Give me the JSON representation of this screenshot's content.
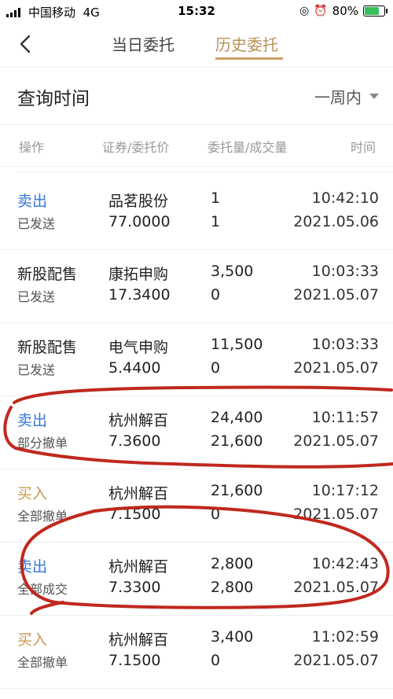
{
  "status_bar": {
    "carrier": "中国移动",
    "network": "4G",
    "time": "15:32",
    "battery_percent": "80%",
    "battery_level": 0.8
  },
  "header": {
    "tabs": [
      {
        "label": "当日委托",
        "active": false
      },
      {
        "label": "历史委托",
        "active": true
      }
    ],
    "accent_color": "#c9a063"
  },
  "query": {
    "label": "查询时间",
    "range_value": "一周内"
  },
  "columns": [
    "操作",
    "证券/委托价",
    "委托量/成交量",
    "时间"
  ],
  "orders": [
    {
      "op": "卖出",
      "side": "sell",
      "status": "已发送",
      "name": "品茗股份",
      "price": "77.0000",
      "qty": "1",
      "deal": "1",
      "time": "10:42:10",
      "date": "2021.05.06"
    },
    {
      "op": "新股配售",
      "side": "other",
      "status": "已发送",
      "name": "康拓申购",
      "price": "17.3400",
      "qty": "3,500",
      "deal": "0",
      "time": "10:03:33",
      "date": "2021.05.07"
    },
    {
      "op": "新股配售",
      "side": "other",
      "status": "已发送",
      "name": "电气申购",
      "price": "5.4400",
      "qty": "11,500",
      "deal": "0",
      "time": "10:03:33",
      "date": "2021.05.07"
    },
    {
      "op": "卖出",
      "side": "sell",
      "status": "部分撤单",
      "name": "杭州解百",
      "price": "7.3600",
      "qty": "24,400",
      "deal": "21,600",
      "time": "10:11:57",
      "date": "2021.05.07"
    },
    {
      "op": "买入",
      "side": "buy",
      "status": "全部撤单",
      "name": "杭州解百",
      "price": "7.1500",
      "qty": "21,600",
      "deal": "0",
      "time": "10:17:12",
      "date": "2021.05.07"
    },
    {
      "op": "卖出",
      "side": "sell",
      "status": "全部成交",
      "name": "杭州解百",
      "price": "7.3300",
      "qty": "2,800",
      "deal": "2,800",
      "time": "10:42:43",
      "date": "2021.05.07"
    },
    {
      "op": "买入",
      "side": "buy",
      "status": "全部撤单",
      "name": "杭州解百",
      "price": "7.1500",
      "qty": "3,400",
      "deal": "0",
      "time": "11:02:59",
      "date": "2021.05.07"
    }
  ],
  "colors": {
    "sell": "#3577d6",
    "buy": "#c89a4f",
    "annotation": "#c0281e"
  }
}
